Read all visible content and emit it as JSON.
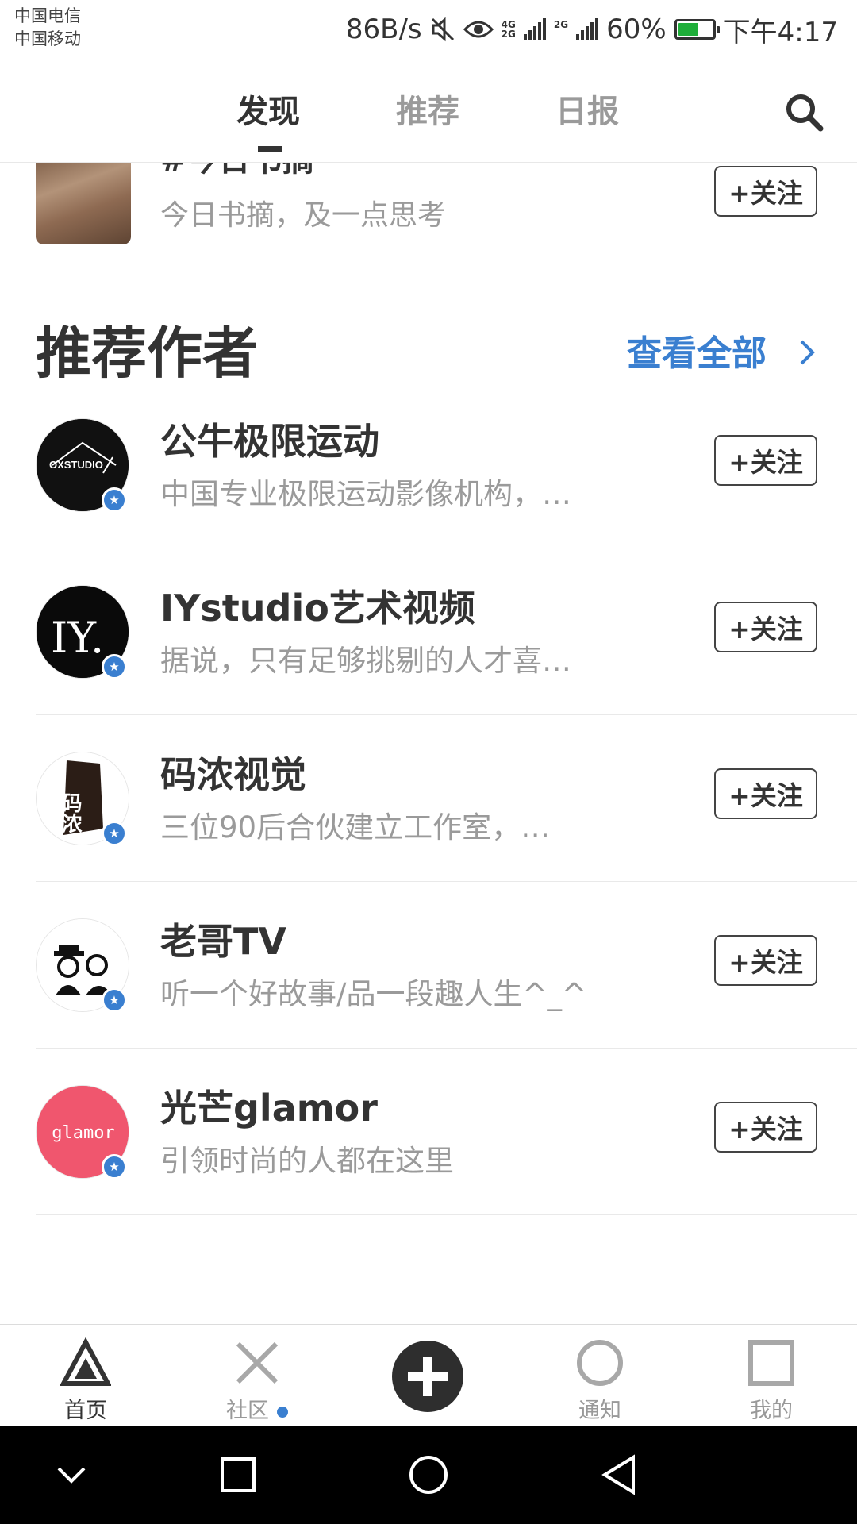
{
  "status_bar": {
    "carrier_1": "中国电信",
    "carrier_2": "中国移动",
    "net_speed": "86B/s",
    "net_type_1a": "4G",
    "net_type_1b": "2G",
    "net_type_2": "2G",
    "battery": "60%",
    "battery_level": 0.6,
    "time": "下午4:17"
  },
  "top_nav": {
    "tabs": [
      {
        "label": "发现",
        "active": true
      },
      {
        "label": "推荐",
        "active": false
      },
      {
        "label": "日报",
        "active": false
      }
    ]
  },
  "partial_item": {
    "title": "#今日书摘",
    "desc": "今日书摘，及一点思考",
    "follow_label": "+关注"
  },
  "section": {
    "title": "推荐作者",
    "see_all": "查看全部"
  },
  "authors": [
    {
      "name": "公牛极限运动",
      "desc": "中国专业极限运动影像机构，…",
      "follow_label": "+关注",
      "avatar_text": "OXSTUDIO"
    },
    {
      "name": "IYstudio艺术视频",
      "desc": "据说，只有足够挑剔的人才喜…",
      "follow_label": "+关注",
      "avatar_text": "IY."
    },
    {
      "name": "码浓视觉",
      "desc": "三位90后合伙建立工作室，…",
      "follow_label": "+关注",
      "avatar_text": "码浓"
    },
    {
      "name": "老哥TV",
      "desc": "听一个好故事/品一段趣人生^_^",
      "follow_label": "+关注",
      "avatar_text": ""
    },
    {
      "name": "光芒glamor",
      "desc": "引领时尚的人都在这里",
      "follow_label": "+关注",
      "avatar_text": "glamor"
    }
  ],
  "bottom_nav": {
    "items": [
      {
        "label": "首页",
        "icon": "triangle-icon",
        "active": true
      },
      {
        "label": "社区",
        "icon": "cross-icon",
        "active": false
      },
      {
        "label": "",
        "icon": "plus-icon",
        "active": false
      },
      {
        "label": "通知",
        "icon": "circle-icon",
        "active": false
      },
      {
        "label": "我的",
        "icon": "square-icon",
        "active": false
      }
    ]
  },
  "colors": {
    "accent": "#3a7fd0",
    "text": "#333333",
    "muted": "#9a9a9a",
    "glamor_avatar": "#f0566e"
  }
}
